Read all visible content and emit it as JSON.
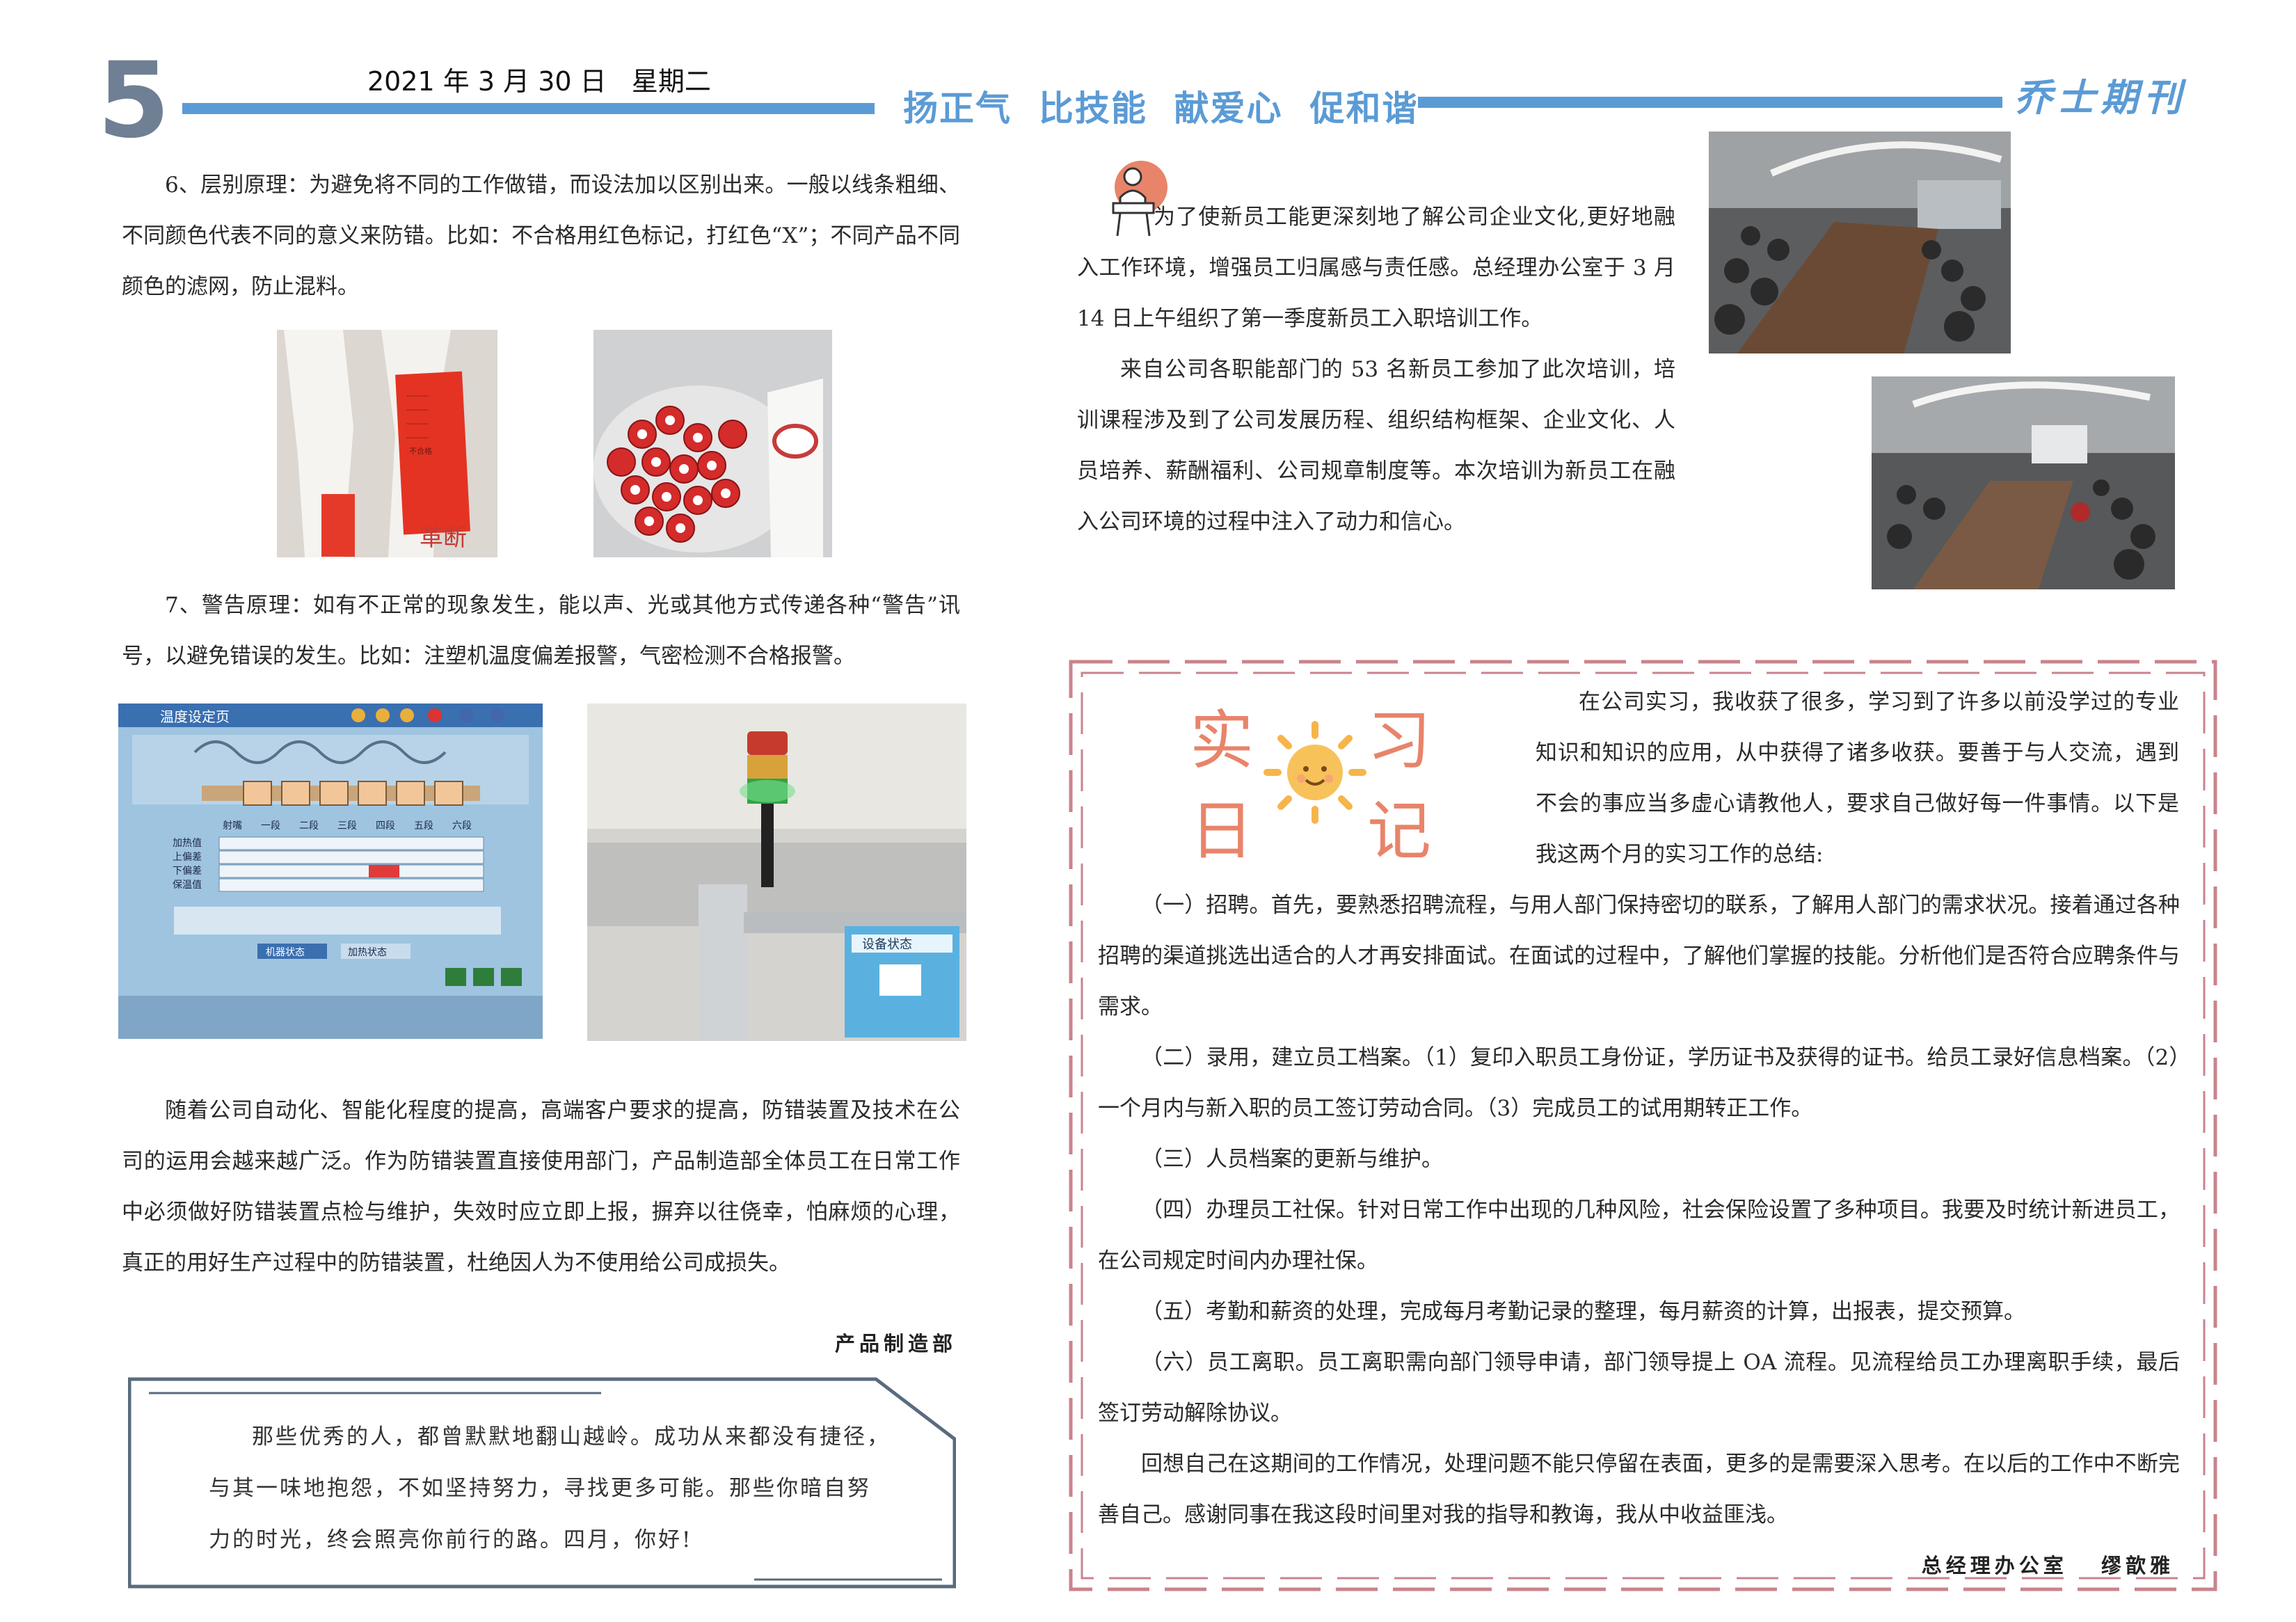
{
  "header": {
    "page_number": "5",
    "date": "2021 年 3 月 30 日   星期二",
    "slogan": "扬正气  比技能  献爱心  促和谐",
    "brand": "乔士期刊"
  },
  "left": {
    "para1": "6、层别原理：为避免将不同的工作做错，而设法加以区别出来。一般以线条粗细、不同颜色代表不同的意义来防错。比如：不合格用红色标记，打红色“X”；不同产品不同颜色的滤网，防止混料。",
    "photo_labels": {
      "red_tag_text": "不合格",
      "handwritten": "革断"
    },
    "para2": "7、警告原理：如有不正常的现象发生，能以声、光或其他方式传递各种“警告”讯号，以避免错误的发生。比如：注塑机温度偏差报警，气密检测不合格报警。",
    "screen": {
      "title": "温度设定页",
      "columns": [
        "射嘴",
        "一段",
        "二段",
        "三段",
        "四段",
        "五段",
        "六段"
      ],
      "rows": [
        "加热值",
        "上偏差",
        "下偏差",
        "保温值"
      ],
      "status": "机器状态",
      "status2": "加热状态"
    },
    "device_label": "设备状态",
    "para3": "随着公司自动化、智能化程度的提高，高端客户要求的提高，防错装置及技术在公司的运用会越来越广泛。作为防错装置直接使用部门，产品制造部全体员工在日常工作中必须做好防错装置点检与维护，失效时应立即上报，摒弃以往侥幸，怕麻烦的心理，真正的用好生产过程中的防错装置，杜绝因人为不使用给公司成损失。",
    "signature": "产品制造部",
    "quote": [
      "那些优秀的人，都曾默默地翻山越岭。成功从来都没有捷径，",
      "与其一味地抱怨，不如坚持努力，寻找更多可能。那些你暗自努",
      "力的时光，终会照亮你前行的路。四月，你好!"
    ]
  },
  "right": {
    "training_para1": "为了使新员工能更深刻地了解公司企业文化,更好地融入工作环境，增强员工归属感与责任感。总经理办公室于 3 月 14 日上午组织了第一季度新员工入职培训工作。",
    "training_para2": "来自公司各职能部门的 53 名新员工参加了此次培训，培训课程涉及到了公司发展历程、组织结构框架、企业文化、人员培养、薪酬福利、公司规章制度等。本次培训为新员工在融入公司环境的过程中注入了动力和信心。",
    "diary": {
      "title_chars": [
        "实",
        "习",
        "日",
        "记"
      ],
      "intro": "在公司实习，我收获了很多，学习到了许多以前没学过的专业知识和知识的应用，从中获得了诸多收获。要善于与人交流，遇到不会的事应当多虚心请教他人，要求自己做好每一件事情。以下是我这两个月的实习工作的总结:",
      "items": [
        "（一）招聘。首先，要熟悉招聘流程，与用人部门保持密切的联系，了解用人部门的需求状况。接着通过各种招聘的渠道挑选出适合的人才再安排面试。在面试的过程中，了解他们掌握的技能。分析他们是否符合应聘条件与需求。",
        "（二）录用，建立员工档案。（1）复印入职员工身份证，学历证书及获得的证书。给员工录好信息档案。（2）一个月内与新入职的员工签订劳动合同。（3）完成员工的试用期转正工作。",
        "（三）人员档案的更新与维护。",
        "（四）办理员工社保。针对日常工作中出现的几种风险，社会保险设置了多种项目。我要及时统计新进员工，在公司规定时间内办理社保。",
        "（五）考勤和薪资的处理，完成每月考勤记录的整理，每月薪资的计算，出报表，提交预算。",
        "（六）员工离职。员工离职需向部门领导申请，部门领导提上 OA 流程。见流程给员工办理离职手续，最后签订劳动解除协议。",
        "回想自己在这期间的工作情况，处理问题不能只停留在表面，更多的是需要深入思考。在以后的工作中不断完善自己。感谢同事在我这段时间里对我的指导和教诲，我从中收益匪浅。"
      ],
      "signature": "总经理办公室   缪歆雅"
    }
  },
  "colors": {
    "accent_blue": "#5b9bd5",
    "page_number_gray": "#6f7f94",
    "diary_pink": "#c9838c",
    "diary_title": "#e8846a",
    "sun": "#f6b54a"
  }
}
